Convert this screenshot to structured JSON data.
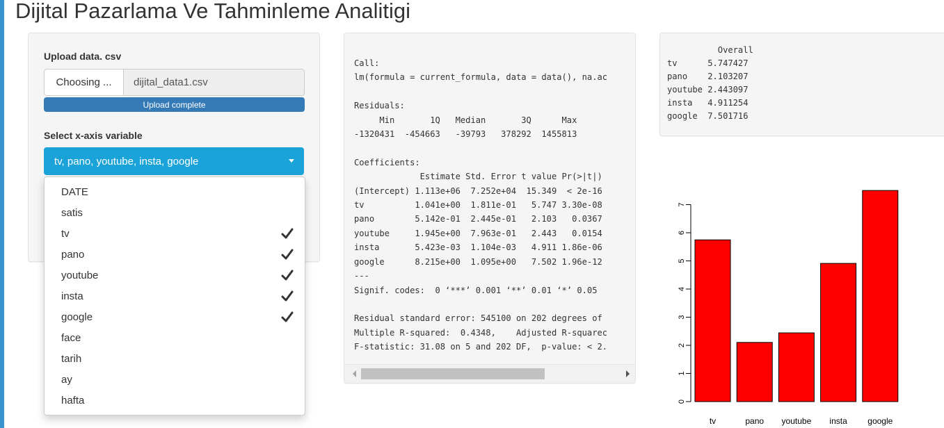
{
  "app": {
    "title": "Dijital Pazarlama Ve Tahminleme Analitigi"
  },
  "sidebar": {
    "upload_label": "Upload data. csv",
    "choose_button": "Choosing ...",
    "file_name": "dijital_data1.csv",
    "progress_text": "Upload complete",
    "progress_percent": 100,
    "select_label": "Select x-axis variable",
    "select_value": "tv, pano, youtube, insta, google",
    "dropdown_items": [
      {
        "label": "DATE",
        "selected": false
      },
      {
        "label": "satis",
        "selected": false
      },
      {
        "label": "tv",
        "selected": true
      },
      {
        "label": "pano",
        "selected": true
      },
      {
        "label": "youtube",
        "selected": true
      },
      {
        "label": "insta",
        "selected": true
      },
      {
        "label": "google",
        "selected": true
      },
      {
        "label": "face",
        "selected": false
      },
      {
        "label": "tarih",
        "selected": false
      },
      {
        "label": "ay",
        "selected": false
      },
      {
        "label": "hafta",
        "selected": false
      }
    ]
  },
  "summary": {
    "text": "Call:\nlm(formula = current_formula, data = data(), na.ac\n\nResiduals:\n     Min       1Q   Median       3Q      Max\n-1320431  -454663   -39793   378292  1455813\n\nCoefficients:\n             Estimate Std. Error t value Pr(>|t|)\n(Intercept) 1.113e+06  7.252e+04  15.349  < 2e-16\ntv          1.041e+00  1.811e-01   5.747 3.30e-08\npano        5.142e-01  2.445e-01   2.103   0.0367\nyoutube     1.945e+00  7.963e-01   2.443   0.0154\ninsta       5.423e-03  1.104e-03   4.911 1.86e-06\ngoogle      8.215e+00  1.095e+00   7.502 1.96e-12\n---\nSignif. codes:  0 ‘***’ 0.001 ‘**’ 0.01 ‘*’ 0.05\n\nResidual standard error: 545100 on 202 degrees of\nMultiple R-squared:  0.4348,    Adjusted R-squarec\nF-statistic: 31.08 on 5 and 202 DF,  p-value: < 2."
  },
  "importance": {
    "text": "          Overall\ntv      5.747427\npano    2.103207\nyoutube 2.443097\ninsta   4.911254\ngoogle  7.501716"
  },
  "chart_data": {
    "type": "bar",
    "categories": [
      "tv",
      "pano",
      "youtube",
      "insta",
      "google"
    ],
    "values": [
      5.747427,
      2.103207,
      2.443097,
      4.911254,
      7.501716
    ],
    "title": "",
    "xlabel": "",
    "ylabel": "",
    "ylim": [
      0,
      7.5
    ],
    "yticks": [
      "0",
      "1",
      "2",
      "3",
      "4",
      "5",
      "6",
      "7"
    ],
    "bar_color": "#ff0000",
    "grid": false
  },
  "colors": {
    "accent": "#1aa3d9",
    "progress": "#337ab7",
    "left_border": "#3a93cf"
  }
}
